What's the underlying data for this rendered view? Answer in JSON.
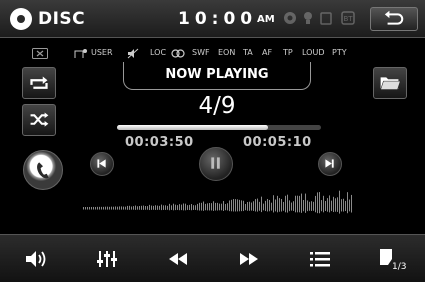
{
  "header": {
    "source": "DISC",
    "time": "10:00",
    "ampm": "AM",
    "indicators": [
      "circle-icon",
      "lightbulb-icon",
      "card-icon",
      "bluetooth-icon"
    ]
  },
  "status": {
    "items": [
      "USER",
      "LOC",
      "SWF",
      "EON",
      "TA",
      "AF",
      "TP",
      "LOUD",
      "PTY"
    ]
  },
  "player": {
    "title": "NOW PLAYING",
    "track": "4/9",
    "elapsed": "00:03:50",
    "total": "00:05:10",
    "progress_percent": 74
  },
  "bottom": {
    "page": "1/3",
    "items": [
      "volume-icon",
      "equalizer-icon",
      "rewind-icon",
      "fast-forward-icon",
      "list-icon",
      "page-icon"
    ]
  },
  "colors": {
    "accent": "#ffffff",
    "background": "#000000",
    "bar": "#1f1f1f"
  }
}
